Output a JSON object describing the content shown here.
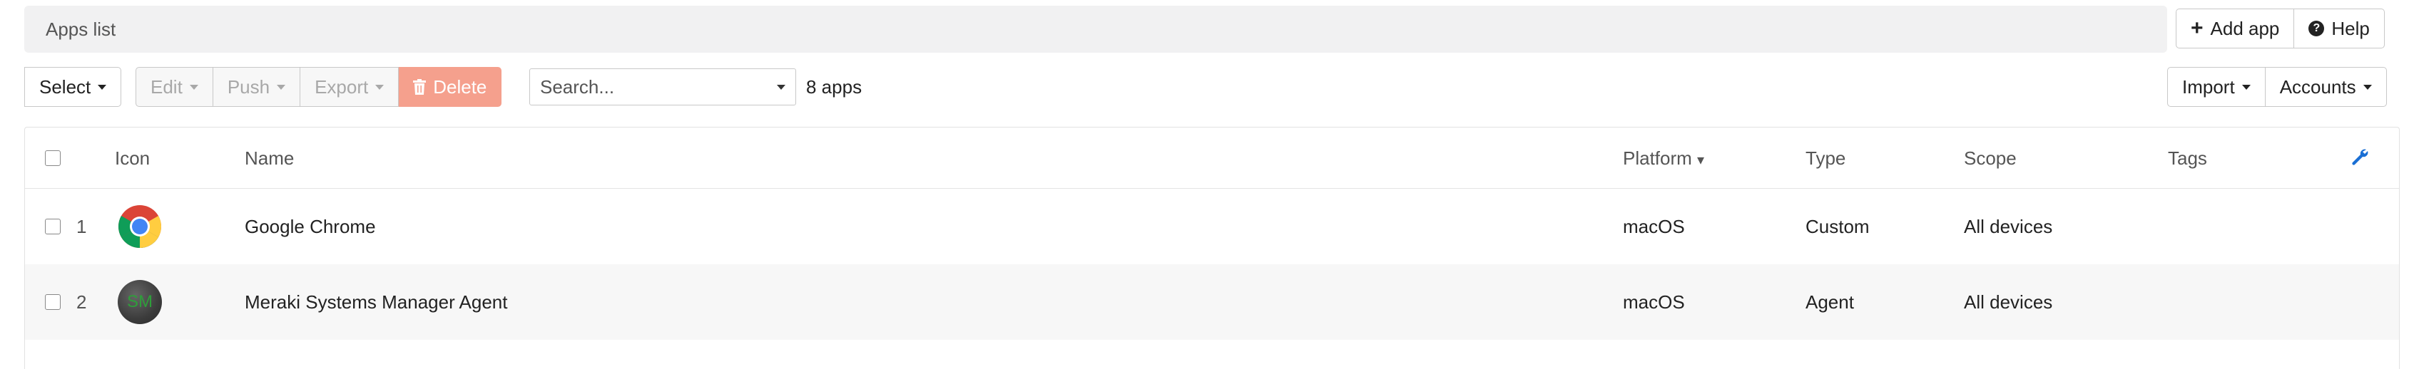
{
  "header": {
    "title": "Apps list"
  },
  "top_buttons": {
    "add_app": "Add app",
    "help": "Help"
  },
  "toolbar": {
    "select": "Select",
    "edit": "Edit",
    "push": "Push",
    "export": "Export",
    "delete": "Delete",
    "search_placeholder": "Search...",
    "count": "8 apps",
    "import": "Import",
    "accounts": "Accounts"
  },
  "table": {
    "headers": {
      "icon": "Icon",
      "name": "Name",
      "platform": "Platform",
      "platform_sort": "▾",
      "type": "Type",
      "scope": "Scope",
      "tags": "Tags"
    },
    "rows": [
      {
        "num": "1",
        "icon": "chrome-icon",
        "name": "Google Chrome",
        "platform": "macOS",
        "type": "Custom",
        "scope": "All devices",
        "tags": ""
      },
      {
        "num": "2",
        "icon": "sm-agent-icon",
        "icon_text": "SM",
        "name": "Meraki Systems Manager Agent",
        "platform": "macOS",
        "type": "Agent",
        "scope": "All devices",
        "tags": ""
      }
    ]
  },
  "colors": {
    "danger": "#f5a08d",
    "accent": "#1a6fd4",
    "header_bg": "#f1f1f2",
    "row_alt": "#f7f7f7"
  }
}
